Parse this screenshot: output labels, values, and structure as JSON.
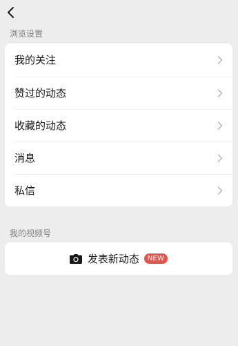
{
  "header": {
    "back_icon": "back-arrow-icon"
  },
  "browse_settings": {
    "title": "浏览设置",
    "items": [
      {
        "label": "我的关注",
        "icon": "chevron-right-icon"
      },
      {
        "label": "赞过的动态",
        "icon": "chevron-right-icon"
      },
      {
        "label": "收藏的动态",
        "icon": "chevron-right-icon"
      },
      {
        "label": "消息",
        "icon": "chevron-right-icon"
      },
      {
        "label": "私信",
        "icon": "chevron-right-icon"
      }
    ]
  },
  "my_channel": {
    "title": "我的视频号",
    "publish_label": "发表新动态",
    "publish_icon": "camera-icon",
    "badge": "NEW"
  },
  "colors": {
    "background": "#ededed",
    "card": "#ffffff",
    "badge": "#e5534b",
    "section_title": "#7f7f7f"
  }
}
